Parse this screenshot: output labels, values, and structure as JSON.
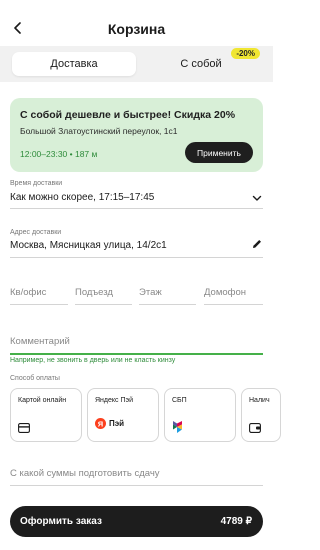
{
  "header": {
    "title": "Корзина",
    "back_icon": "arrow-left-icon"
  },
  "tabs": {
    "delivery": "Доставка",
    "pickup": "С собой",
    "pickup_badge": "-20%"
  },
  "promo": {
    "title": "С собой дешевле и быстрее! Скидка 20%",
    "address": "Большой Златоустинский переулок, 1с1",
    "time_distance": "12:00–23:30 • 187 м",
    "button": "Применить"
  },
  "delivery_time": {
    "label": "Время доставки",
    "value": "Как можно скорее, 17:15–17:45"
  },
  "address": {
    "label": "Адрес доставки",
    "value": "Москва, Мясницкая улица, 14/2с1"
  },
  "address_parts": {
    "apartment": "Кв/офис",
    "entrance": "Подъезд",
    "floor": "Этаж",
    "intercom": "Домофон"
  },
  "comment": {
    "placeholder": "Комментарий",
    "hint": "Например, не звонить в дверь или не класть кинзу"
  },
  "payment": {
    "label": "Способ оплаты",
    "methods": [
      {
        "title": "Картой онлайн",
        "icon": "card-icon"
      },
      {
        "title": "Яндекс Пэй",
        "icon": "yandex-pay-icon",
        "brand": "Пэй"
      },
      {
        "title": "СБП",
        "icon": "sbp-icon"
      },
      {
        "title": "Налич",
        "icon": "wallet-icon"
      }
    ]
  },
  "change": {
    "placeholder": "С какой суммы подготовить сдачу"
  },
  "checkout": {
    "label": "Оформить заказ",
    "total": "4789 ₽"
  },
  "colors": {
    "accent_green": "#45b049",
    "promo_bg": "#d8efd7",
    "badge_yellow": "#f0e632",
    "dark": "#1d1d1d"
  }
}
